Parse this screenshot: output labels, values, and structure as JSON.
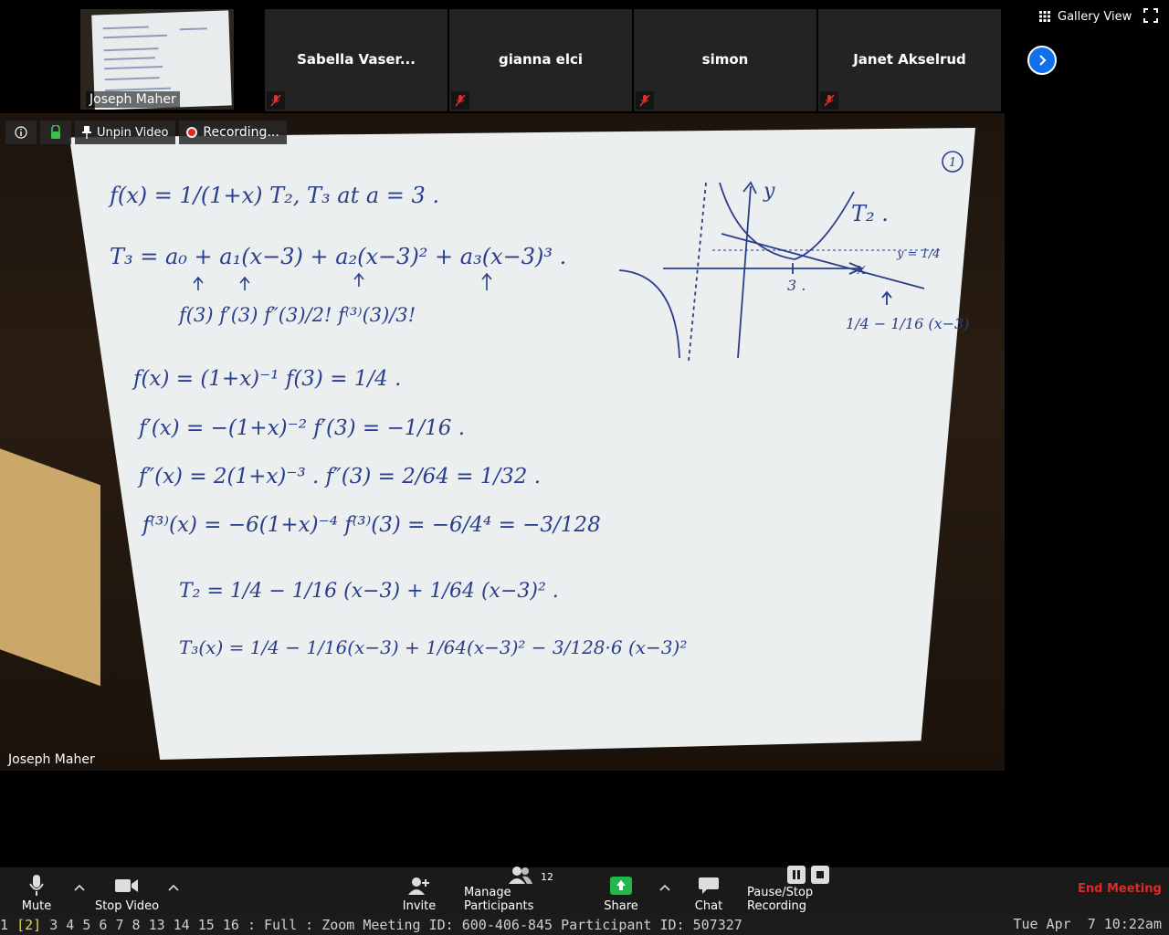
{
  "gallery": {
    "self_name": "Joseph Maher",
    "participants": [
      {
        "name": "Sabella Vaser..."
      },
      {
        "name": "gianna elci"
      },
      {
        "name": "simon"
      },
      {
        "name": "Janet Akselrud"
      }
    ],
    "view_label": "Gallery View"
  },
  "main_video": {
    "overlay": {
      "unpin_label": "Unpin Video",
      "recording_label": "Recording..."
    },
    "speaker_name": "Joseph Maher",
    "whiteboard": {
      "page_number": "1",
      "lines": [
        "f(x) = 1/(1+x)      T₂, T₃   at  a = 3 .",
        "T₃ =  a₀ + a₁(x−3) + a₂(x−3)² + a₃(x−3)³ .",
        "f(3)     f′(3)        f″(3)/2!       f⁽³⁾(3)/3!",
        "f(x) = (1+x)⁻¹                f(3) = 1/4 .",
        "f′(x) = −(1+x)⁻²              f′(3) = −1/16 .",
        "f″(x) = 2(1+x)⁻³ .            f″(3) = 2/64 = 1/32 .",
        "f⁽³⁾(x) = −6(1+x)⁻⁴           f⁽³⁾(3) = −6/4⁴ = −3/128",
        "T₂ = 1/4 − 1/16 (x−3) + 1/64 (x−3)² .",
        "T₃(x) = 1/4 − 1/16(x−3) + 1/64(x−3)² − 3/128·6 (x−3)²"
      ],
      "graph_labels": {
        "y_axis": "y",
        "x_axis": "x",
        "curve": "T₂ .",
        "asymptote": "y = 1/4",
        "point": "3 .",
        "tangent": "1/4 − 1/16 (x−3)"
      }
    }
  },
  "controls": {
    "mute": "Mute",
    "stop_video": "Stop Video",
    "invite": "Invite",
    "manage_participants": "Manage Participants",
    "participant_count": "12",
    "share": "Share",
    "chat": "Chat",
    "pause_stop_recording": "Pause/Stop Recording",
    "end_meeting": "End Meeting"
  },
  "statusbar": {
    "workspaces": [
      "1",
      "[2]",
      "3",
      "4",
      "5",
      "6",
      "7",
      "8",
      "13",
      "14",
      "15",
      "16"
    ],
    "active_workspace": "[2]",
    "layout": ": Full :",
    "window_title": "Zoom Meeting ID: 600-406-845 Participant ID: 507327",
    "clock": "Tue Apr  7 10:22am"
  },
  "colors": {
    "share_green": "#21b74a",
    "end_meeting_red": "#e02828",
    "accent_blue": "#0e71eb",
    "ink_blue": "#2a3e8c"
  }
}
